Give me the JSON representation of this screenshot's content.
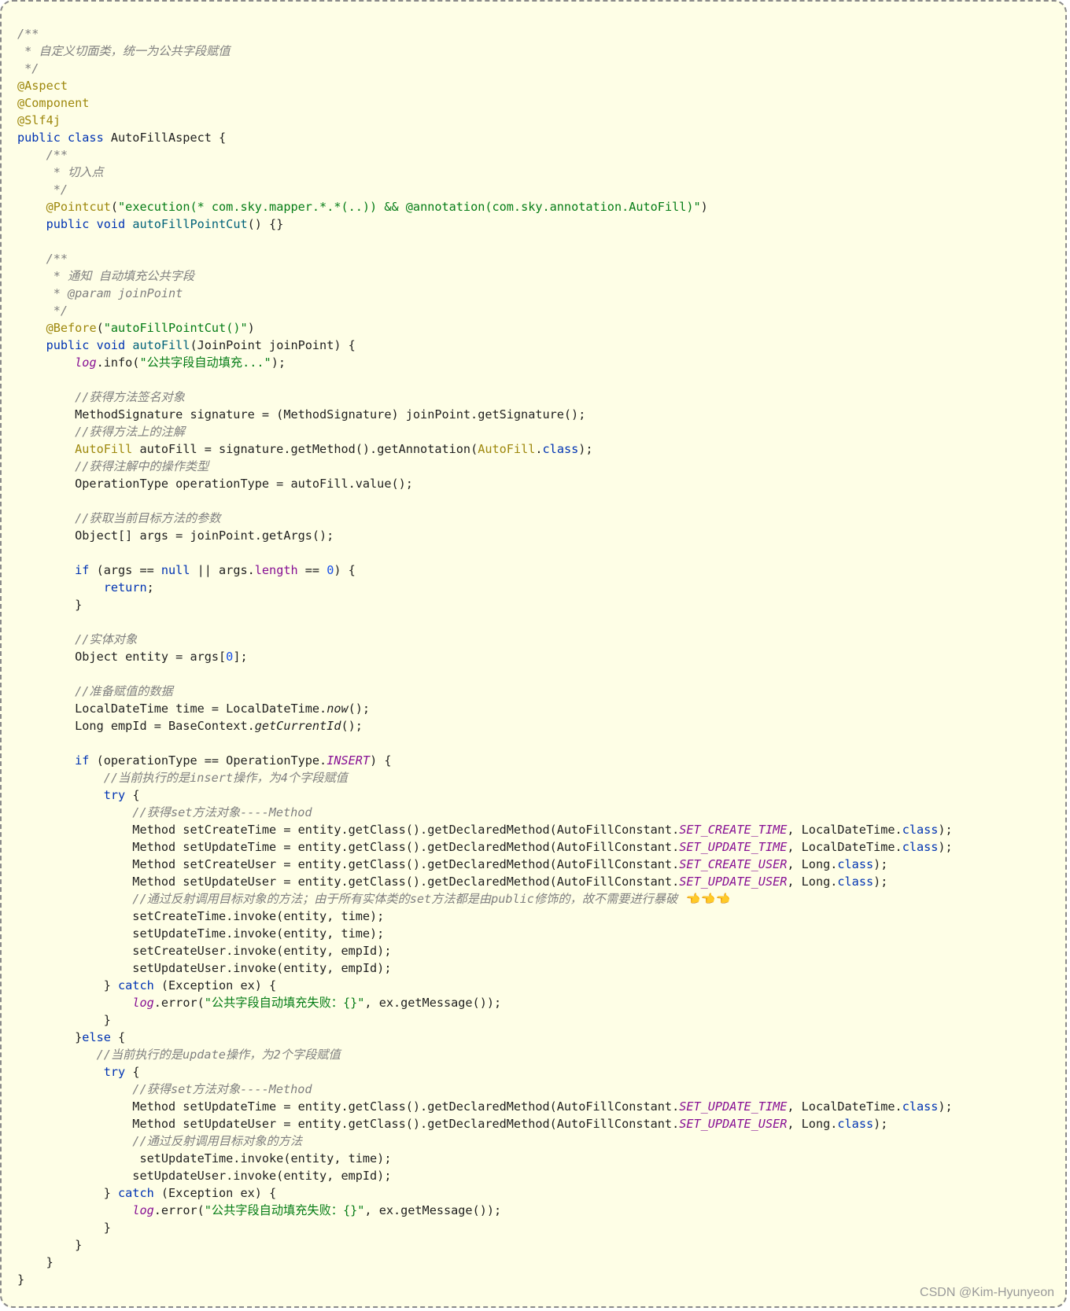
{
  "code": {
    "lines": [
      [
        [
          "cm",
          "/**"
        ]
      ],
      [
        [
          "cm",
          " * 自定义切面类，统一为公共字段赋值"
        ]
      ],
      [
        [
          "cm",
          " */"
        ]
      ],
      [
        [
          "an",
          "@Aspect"
        ]
      ],
      [
        [
          "an",
          "@Component"
        ]
      ],
      [
        [
          "an",
          "@Slf4j"
        ]
      ],
      [
        [
          "kw",
          "public class "
        ],
        [
          "tx",
          "AutoFillAspect {"
        ]
      ],
      [
        [
          "cm",
          "    /**"
        ]
      ],
      [
        [
          "cm",
          "     * 切入点"
        ]
      ],
      [
        [
          "cm",
          "     */"
        ]
      ],
      [
        [
          "tx",
          "    "
        ],
        [
          "an",
          "@Pointcut"
        ],
        [
          "tx",
          "("
        ],
        [
          "st",
          "\"execution(* com.sky.mapper.*.*(..)) && @annotation(com.sky.annotation.AutoFill)\""
        ],
        [
          "tx",
          ")"
        ]
      ],
      [
        [
          "tx",
          "    "
        ],
        [
          "kw",
          "public void "
        ],
        [
          "fn",
          "autoFillPointCut"
        ],
        [
          "tx",
          "() {}"
        ]
      ],
      [
        [
          "tx",
          ""
        ]
      ],
      [
        [
          "cm",
          "    /**"
        ]
      ],
      [
        [
          "cm",
          "     * 通知 自动填充公共字段"
        ]
      ],
      [
        [
          "cm",
          "     * @param joinPoint"
        ]
      ],
      [
        [
          "cm",
          "     */"
        ]
      ],
      [
        [
          "tx",
          "    "
        ],
        [
          "an",
          "@Before"
        ],
        [
          "tx",
          "("
        ],
        [
          "st",
          "\"autoFillPointCut()\""
        ],
        [
          "tx",
          ")"
        ]
      ],
      [
        [
          "tx",
          "    "
        ],
        [
          "kw",
          "public void "
        ],
        [
          "fn",
          "autoFill"
        ],
        [
          "tx",
          "(JoinPoint joinPoint) {"
        ]
      ],
      [
        [
          "tx",
          "        "
        ],
        [
          "sf",
          "log"
        ],
        [
          "tx",
          ".info("
        ],
        [
          "st",
          "\"公共字段自动填充...\""
        ],
        [
          "tx",
          ");"
        ]
      ],
      [
        [
          "tx",
          ""
        ]
      ],
      [
        [
          "cm",
          "        //获得方法签名对象"
        ]
      ],
      [
        [
          "tx",
          "        MethodSignature signature = (MethodSignature) joinPoint.getSignature();"
        ]
      ],
      [
        [
          "cm",
          "        //获得方法上的注解"
        ]
      ],
      [
        [
          "tx",
          "        "
        ],
        [
          "an",
          "AutoFill"
        ],
        [
          "tx",
          " autoFill = signature.getMethod().getAnnotation("
        ],
        [
          "an",
          "AutoFill"
        ],
        [
          "tx",
          "."
        ],
        [
          "kw",
          "class"
        ],
        [
          "tx",
          ");"
        ]
      ],
      [
        [
          "cm",
          "        //获得注解中的操作类型"
        ]
      ],
      [
        [
          "tx",
          "        OperationType operationType = autoFill.value();"
        ]
      ],
      [
        [
          "tx",
          ""
        ]
      ],
      [
        [
          "cm",
          "        //获取当前目标方法的参数"
        ]
      ],
      [
        [
          "tx",
          "        Object[] args = joinPoint.getArgs();"
        ]
      ],
      [
        [
          "tx",
          ""
        ]
      ],
      [
        [
          "tx",
          "        "
        ],
        [
          "kw",
          "if"
        ],
        [
          "tx",
          " (args == "
        ],
        [
          "kw",
          "null"
        ],
        [
          "tx",
          " || args."
        ],
        [
          "pf",
          "length"
        ],
        [
          "tx",
          " == "
        ],
        [
          "nu",
          "0"
        ],
        [
          "tx",
          ") {"
        ]
      ],
      [
        [
          "tx",
          "            "
        ],
        [
          "kw",
          "return"
        ],
        [
          "tx",
          ";"
        ]
      ],
      [
        [
          "tx",
          "        }"
        ]
      ],
      [
        [
          "tx",
          ""
        ]
      ],
      [
        [
          "cm",
          "        //实体对象"
        ]
      ],
      [
        [
          "tx",
          "        Object entity = args["
        ],
        [
          "nu",
          "0"
        ],
        [
          "tx",
          "];"
        ]
      ],
      [
        [
          "tx",
          ""
        ]
      ],
      [
        [
          "cm",
          "        //准备赋值的数据"
        ]
      ],
      [
        [
          "tx",
          "        LocalDateTime time = LocalDateTime."
        ],
        [
          "it",
          "now"
        ],
        [
          "tx",
          "();"
        ]
      ],
      [
        [
          "tx",
          "        Long empId = BaseContext."
        ],
        [
          "it",
          "getCurrentId"
        ],
        [
          "tx",
          "();"
        ]
      ],
      [
        [
          "tx",
          ""
        ]
      ],
      [
        [
          "tx",
          "        "
        ],
        [
          "kw",
          "if"
        ],
        [
          "tx",
          " (operationType == OperationType."
        ],
        [
          "sf",
          "INSERT"
        ],
        [
          "tx",
          ") {"
        ]
      ],
      [
        [
          "cm",
          "            //当前执行的是insert操作，为4个字段赋值"
        ]
      ],
      [
        [
          "tx",
          "            "
        ],
        [
          "kw",
          "try"
        ],
        [
          "tx",
          " {"
        ]
      ],
      [
        [
          "cm",
          "                //获得set方法对象----Method"
        ]
      ],
      [
        [
          "tx",
          "                Method setCreateTime = entity.getClass().getDeclaredMethod(AutoFillConstant."
        ],
        [
          "sf",
          "SET_CREATE_TIME"
        ],
        [
          "tx",
          ", LocalDateTime."
        ],
        [
          "kw",
          "class"
        ],
        [
          "tx",
          ");"
        ]
      ],
      [
        [
          "tx",
          "                Method setUpdateTime = entity.getClass().getDeclaredMethod(AutoFillConstant."
        ],
        [
          "sf",
          "SET_UPDATE_TIME"
        ],
        [
          "tx",
          ", LocalDateTime."
        ],
        [
          "kw",
          "class"
        ],
        [
          "tx",
          ");"
        ]
      ],
      [
        [
          "tx",
          "                Method setCreateUser = entity.getClass().getDeclaredMethod(AutoFillConstant."
        ],
        [
          "sf",
          "SET_CREATE_USER"
        ],
        [
          "tx",
          ", Long."
        ],
        [
          "kw",
          "class"
        ],
        [
          "tx",
          ");"
        ]
      ],
      [
        [
          "tx",
          "                Method setUpdateUser = entity.getClass().getDeclaredMethod(AutoFillConstant."
        ],
        [
          "sf",
          "SET_UPDATE_USER"
        ],
        [
          "tx",
          ", Long."
        ],
        [
          "kw",
          "class"
        ],
        [
          "tx",
          ");"
        ]
      ],
      [
        [
          "cm",
          "                //通过反射调用目标对象的方法；由于所有实体类的set方法都是由public修饰的，故不需要进行暴破 👈👈👈"
        ]
      ],
      [
        [
          "tx",
          "                setCreateTime.invoke(entity, time);"
        ]
      ],
      [
        [
          "tx",
          "                setUpdateTime.invoke(entity, time);"
        ]
      ],
      [
        [
          "tx",
          "                setCreateUser.invoke(entity, empId);"
        ]
      ],
      [
        [
          "tx",
          "                setUpdateUser.invoke(entity, empId);"
        ]
      ],
      [
        [
          "tx",
          "            } "
        ],
        [
          "kw",
          "catch"
        ],
        [
          "tx",
          " (Exception ex) {"
        ]
      ],
      [
        [
          "tx",
          "                "
        ],
        [
          "sf",
          "log"
        ],
        [
          "tx",
          ".error("
        ],
        [
          "st",
          "\"公共字段自动填充失败：{}\""
        ],
        [
          "tx",
          ", ex.getMessage());"
        ]
      ],
      [
        [
          "tx",
          "            }"
        ]
      ],
      [
        [
          "tx",
          "        }"
        ],
        [
          "kw",
          "else"
        ],
        [
          "tx",
          " {"
        ]
      ],
      [
        [
          "cm",
          "           //当前执行的是update操作，为2个字段赋值"
        ]
      ],
      [
        [
          "tx",
          "            "
        ],
        [
          "kw",
          "try"
        ],
        [
          "tx",
          " {"
        ]
      ],
      [
        [
          "cm",
          "                //获得set方法对象----Method"
        ]
      ],
      [
        [
          "tx",
          "                Method setUpdateTime = entity.getClass().getDeclaredMethod(AutoFillConstant."
        ],
        [
          "sf",
          "SET_UPDATE_TIME"
        ],
        [
          "tx",
          ", LocalDateTime."
        ],
        [
          "kw",
          "class"
        ],
        [
          "tx",
          ");"
        ]
      ],
      [
        [
          "tx",
          "                Method setUpdateUser = entity.getClass().getDeclaredMethod(AutoFillConstant."
        ],
        [
          "sf",
          "SET_UPDATE_USER"
        ],
        [
          "tx",
          ", Long."
        ],
        [
          "kw",
          "class"
        ],
        [
          "tx",
          ");"
        ]
      ],
      [
        [
          "cm",
          "                //通过反射调用目标对象的方法"
        ]
      ],
      [
        [
          "tx",
          "                 setUpdateTime.invoke(entity, time);"
        ]
      ],
      [
        [
          "tx",
          "                setUpdateUser.invoke(entity, empId);"
        ]
      ],
      [
        [
          "tx",
          "            } "
        ],
        [
          "kw",
          "catch"
        ],
        [
          "tx",
          " (Exception ex) {"
        ]
      ],
      [
        [
          "tx",
          "                "
        ],
        [
          "sf",
          "log"
        ],
        [
          "tx",
          ".error("
        ],
        [
          "st",
          "\"公共字段自动填充失败：{}\""
        ],
        [
          "tx",
          ", ex.getMessage());"
        ]
      ],
      [
        [
          "tx",
          "            }"
        ]
      ],
      [
        [
          "tx",
          "        }"
        ]
      ],
      [
        [
          "tx",
          "    }"
        ]
      ],
      [
        [
          "tx",
          "}"
        ]
      ]
    ]
  },
  "watermark": "CSDN @Kim-Hyunyeon",
  "colors": {
    "background": "#fefee6",
    "comment": "#808080",
    "annotation": "#9e880d",
    "keyword": "#0033b3",
    "method_declaration": "#00627a",
    "string": "#067d17",
    "number": "#1750eb",
    "static_field": "#871094"
  }
}
